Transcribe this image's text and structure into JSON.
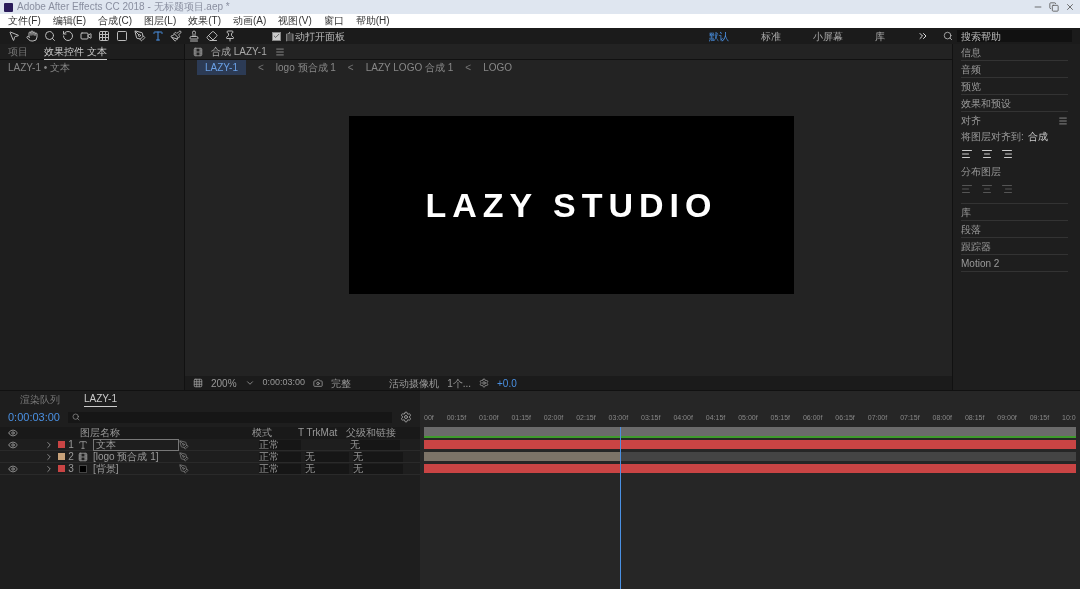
{
  "window": {
    "title": "Adobe After Effects CC 2018 - 无标题项目.aep *"
  },
  "menu": [
    "文件(F)",
    "编辑(E)",
    "合成(C)",
    "图层(L)",
    "效果(T)",
    "动画(A)",
    "视图(V)",
    "窗口",
    "帮助(H)"
  ],
  "toolbar": {
    "auto_open": {
      "label": "自动打开面板",
      "checked": true
    }
  },
  "workspaces": [
    {
      "label": "默认",
      "selected": true
    },
    {
      "label": "标准",
      "selected": false
    },
    {
      "label": "小屏幕",
      "selected": false
    },
    {
      "label": "库",
      "selected": false
    }
  ],
  "search": {
    "placeholder": "搜索帮助"
  },
  "left_panel": {
    "tabs": [
      {
        "label": "项目",
        "selected": false
      },
      {
        "label": "效果控件 文本",
        "selected": true
      }
    ],
    "breadcrumb": "LAZY-1 • 文本"
  },
  "viewer": {
    "tab": "合成 LAZY-1",
    "breadcrumbs": [
      {
        "label": "LAZY-1",
        "selected": true
      },
      {
        "label": "logo 预合成 1",
        "selected": false
      },
      {
        "label": "LAZY LOGO 合成 1",
        "selected": false
      },
      {
        "label": "LOGO",
        "selected": false
      }
    ],
    "separator": "<",
    "canvas_text": "LAZY STUDIO",
    "zoom": "200%",
    "time": "0:00:03:00",
    "resolution": "完整",
    "camera": "活动摄像机",
    "views": "1个...",
    "exposure": "+0.0"
  },
  "right_panel": {
    "items": [
      {
        "kind": "panel",
        "label": "信息"
      },
      {
        "kind": "panel",
        "label": "音频"
      },
      {
        "kind": "panel",
        "label": "预览"
      },
      {
        "kind": "panel",
        "label": "效果和预设"
      },
      {
        "kind": "align",
        "label": "对齐",
        "align_to_label": "将图层对齐到:",
        "align_to": "合成",
        "distribute_label": "分布图层"
      },
      {
        "kind": "panel",
        "label": "库"
      },
      {
        "kind": "panel",
        "label": "段落"
      },
      {
        "kind": "panel",
        "label": "跟踪器"
      },
      {
        "kind": "panel",
        "label": "Motion 2"
      }
    ]
  },
  "timeline": {
    "tabs": [
      {
        "label": "渲染队列",
        "selected": false
      },
      {
        "label": "LAZY-1",
        "selected": true
      }
    ],
    "time": "0:00:03:00",
    "columns": [
      "图层名称",
      "模式",
      "T TrkMat",
      "父级和链接"
    ],
    "layers": [
      {
        "number": "1",
        "kind": "text",
        "name": "文本",
        "color": "#c94444",
        "visible": true,
        "mode": "正常",
        "parent": "无",
        "level": 1
      },
      {
        "number": "2",
        "kind": "precomp",
        "name": "[logo 预合成 1]",
        "color": "#c8a27a",
        "visible": false,
        "mode": "正常",
        "trkmat": "无",
        "parent": "无",
        "level": 0.3
      },
      {
        "number": "3",
        "kind": "solid",
        "name": "[背景]",
        "color": "#c94444",
        "visible": true,
        "mode": "正常",
        "trkmat": "无",
        "parent": "无",
        "level": 1
      }
    ],
    "ruler": [
      "00f",
      "00:15f",
      "01:00f",
      "01:15f",
      "02:00f",
      "02:15f",
      "03:00f",
      "03:15f",
      "04:00f",
      "04:15f",
      "05:00f",
      "05:15f",
      "06:00f",
      "06:15f",
      "07:00f",
      "07:15f",
      "08:00f",
      "08:15f",
      "09:00f",
      "09:15f",
      "10:0"
    ],
    "playhead": {
      "level": 0.3
    }
  }
}
